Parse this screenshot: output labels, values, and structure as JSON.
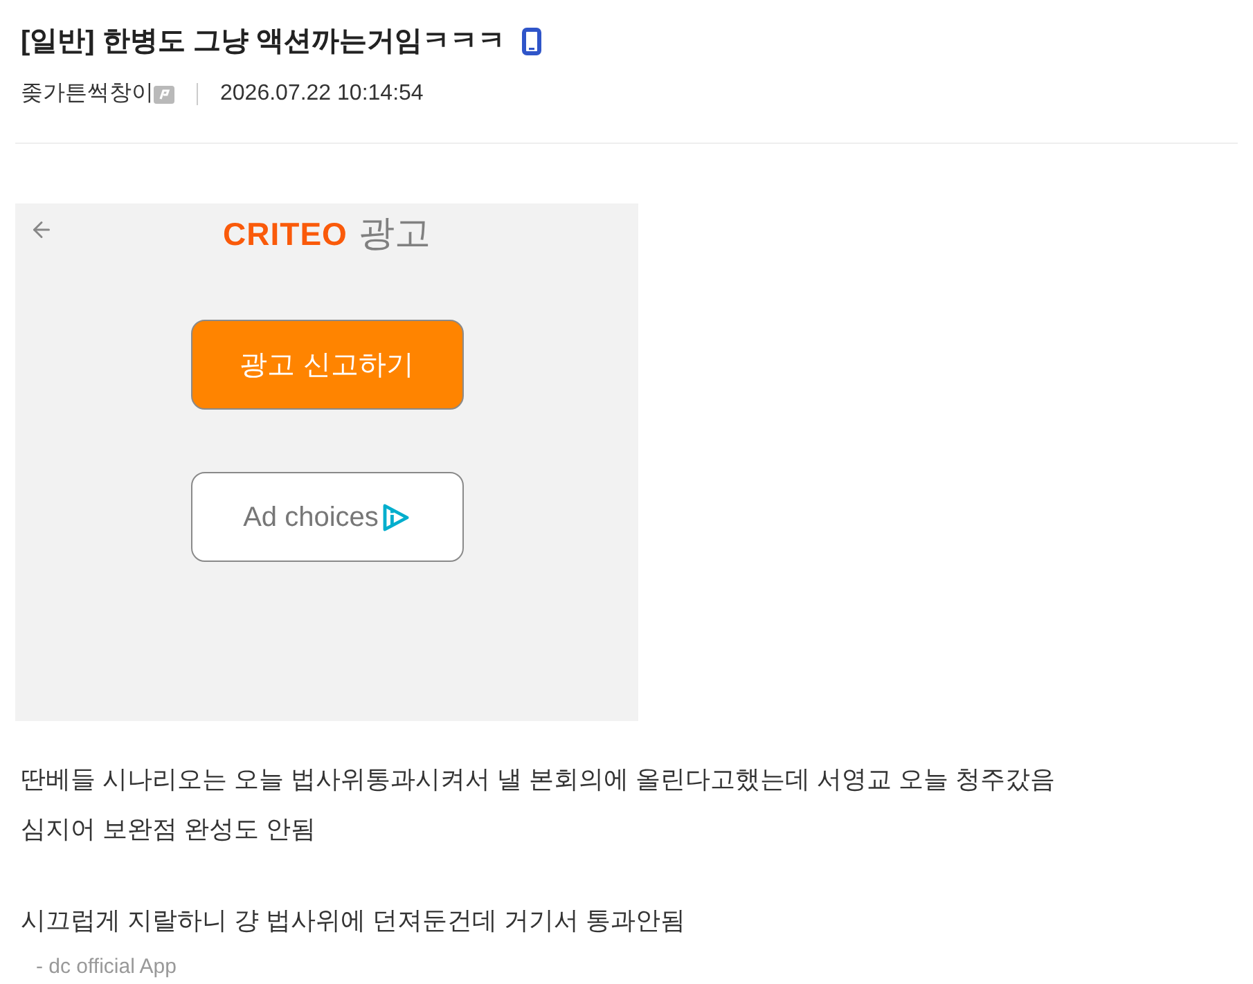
{
  "post": {
    "title": "[일반] 한병도 그냥 액션까는거임ㅋㅋㅋ",
    "author": "좆가튼썩창이",
    "date": "2026.07.22 10:14:54"
  },
  "ad": {
    "logo": "CRITEO",
    "label": "광고",
    "buttons": [
      {
        "kind": "report",
        "label": "광고 신고하기"
      },
      {
        "kind": "choices",
        "label": "Ad choices"
      }
    ]
  },
  "body": {
    "paragraphs": [
      [
        "딴베들 시나리오는 오늘 법사위통과시켜서 낼 본회의에 올린다고했는데 서영교 오늘 청주갔음",
        "심지어 보완점 완성도 안됨"
      ],
      [
        "시끄럽게 지랄하니 걍 법사위에 던져둔건데 거기서 통과안됨"
      ]
    ],
    "signature": "- dc official App"
  }
}
